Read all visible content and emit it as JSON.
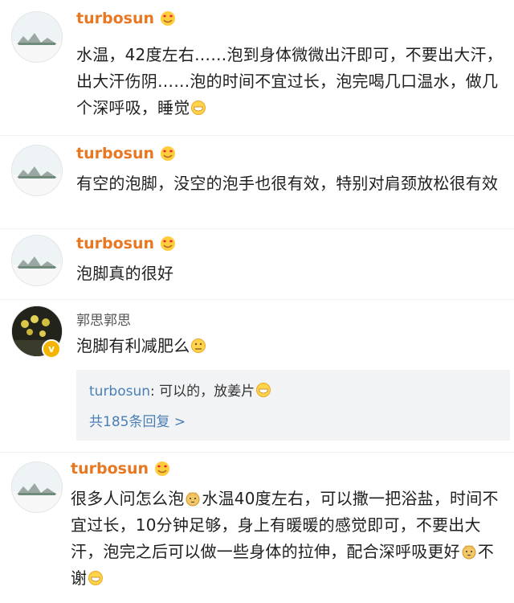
{
  "comments": [
    {
      "user": "turbosun",
      "text_parts": [
        "水温，42度左右……泡到身体微微出汗即可，不要出大汗，出大汗伤阴……泡的时间不宜过长，泡完喝几口温水，做几个深呼吸，睡觉"
      ]
    },
    {
      "user": "turbosun",
      "text_parts": [
        "有空的泡脚，没空的泡手也很有效，特别对肩颈放松很有效"
      ]
    },
    {
      "user": "turbosun",
      "text_parts": [
        "泡脚真的很好"
      ]
    },
    {
      "user": "郭思郭思",
      "text_parts": [
        "泡脚有利减肥么"
      ],
      "reply": {
        "user": "turbosun",
        "separator": ": ",
        "text": "可以的，放姜片",
        "more": "共185条回复 >"
      }
    },
    {
      "user": "turbosun",
      "text_parts": [
        "很多人问怎么泡",
        "水温40度左右，可以撒一把浴盐，时间不宜过长，10分钟足够，身上有暖暖的感觉即可，不要出大汗，泡完之后可以做一些身体的拉伸，配合深呼吸更好",
        "不谢"
      ]
    }
  ],
  "icons": {
    "name_badge": "heart-eyes-emoji-icon",
    "smile": "smile-emoji-icon",
    "doge": "doge-emoji-icon",
    "thinking": "thinking-emoji-icon",
    "verified": "verified-badge-icon"
  },
  "colors": {
    "username": "#e87722",
    "link": "#4a7fb5",
    "reply_bg": "#f2f3f5"
  }
}
